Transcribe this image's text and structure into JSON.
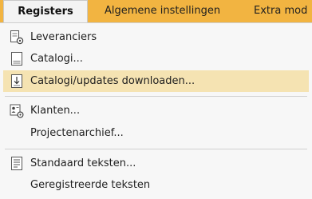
{
  "menubar": {
    "items": [
      {
        "label": "Registers"
      },
      {
        "label": "Algemene instellingen"
      },
      {
        "label": "Extra mod"
      }
    ]
  },
  "menu": {
    "items": [
      {
        "label": "Leveranciers",
        "icon": "supplier-settings-icon"
      },
      {
        "label": "Catalogi...",
        "icon": "catalog-icon"
      },
      {
        "label": "Catalogi/updates downloaden...",
        "icon": "catalog-download-icon",
        "highlighted": true
      },
      {
        "label": "Klanten...",
        "icon": "customer-settings-icon"
      },
      {
        "label": "Projectenarchief...",
        "icon": null
      },
      {
        "label": "Standaard teksten...",
        "icon": "text-document-icon"
      },
      {
        "label": "Geregistreerde teksten",
        "icon": null
      }
    ]
  },
  "colors": {
    "menubar_bg": "#f2b441",
    "highlight_bg": "#f5e3b2",
    "dropdown_bg": "#f7f7f7"
  }
}
